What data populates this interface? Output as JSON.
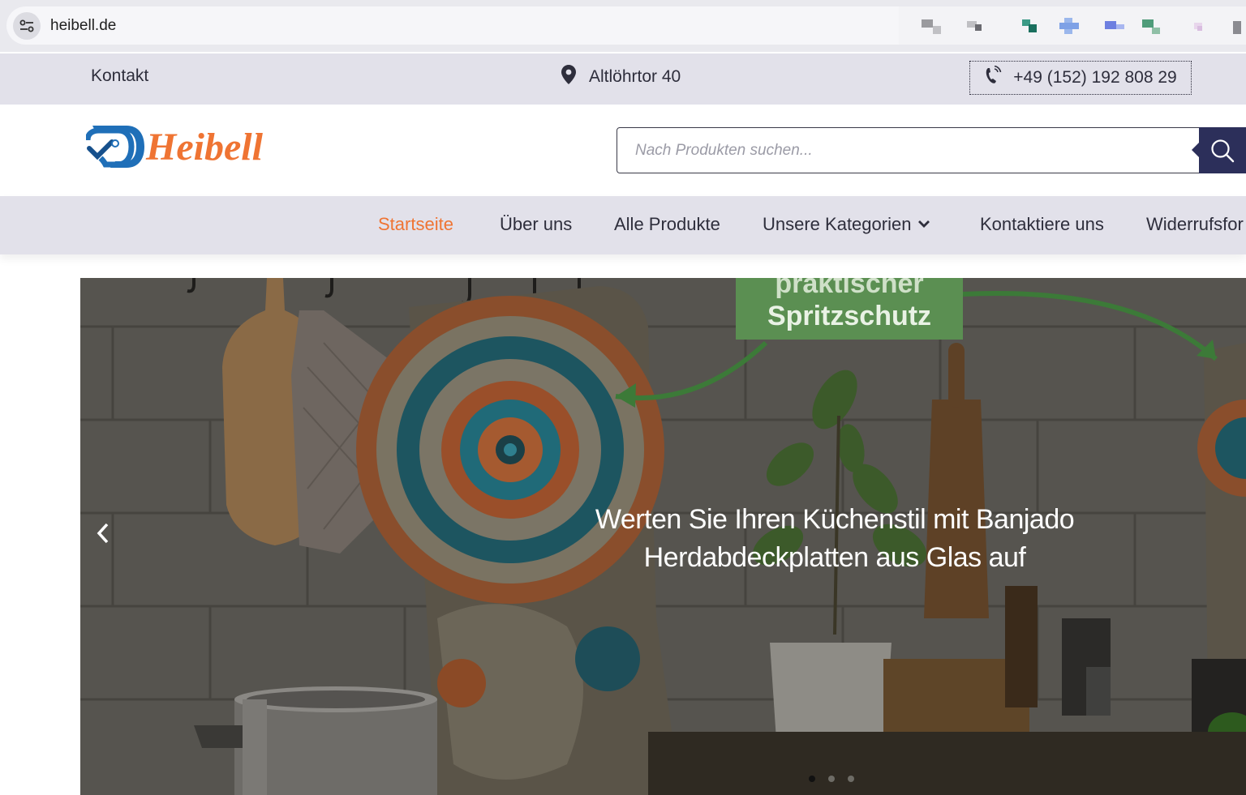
{
  "browser": {
    "url": "heibell.de",
    "site_settings_icon": "tune-icon",
    "extension_icons": [
      "extension-icon-1",
      "extension-icon-2",
      "extension-icon-3",
      "extension-icon-4",
      "extension-icon-5",
      "extension-icon-6",
      "extension-icon-7",
      "extension-icon-8"
    ]
  },
  "topbar": {
    "contact_label": "Kontakt",
    "address": "Altlöhrtor 40",
    "address_icon": "map-pin-icon",
    "phone": "+49 (152) 192 808 29",
    "phone_icon": "phone-icon"
  },
  "header": {
    "logo_text": "Heibell",
    "search_placeholder": "Nach Produkten suchen...",
    "search_icon": "search-icon"
  },
  "nav": {
    "items": [
      {
        "label": "Startseite",
        "active": true
      },
      {
        "label": "Über uns",
        "active": false
      },
      {
        "label": "Alle Produkte",
        "active": false
      },
      {
        "label": "Unsere Kategorien",
        "active": false,
        "dropdown": true
      },
      {
        "label": "Kontaktiere uns",
        "active": false
      },
      {
        "label": "Widerrufsfor",
        "active": false
      }
    ]
  },
  "hero": {
    "caption_line1": "Werten Sie Ihren Küchenstil mit Banjado",
    "caption_line2": "Herdabdeckplatten aus Glas auf",
    "image_label_top": "praktischer",
    "image_label": "Spritzschutz",
    "slide_count": 3,
    "active_slide": 1,
    "prev_icon": "chevron-left-icon"
  },
  "colors": {
    "accent": "#ef7433",
    "nav_bg": "#e2e1ea",
    "search_button": "#2c2f5a",
    "logo_blue": "#1f6fb8"
  }
}
